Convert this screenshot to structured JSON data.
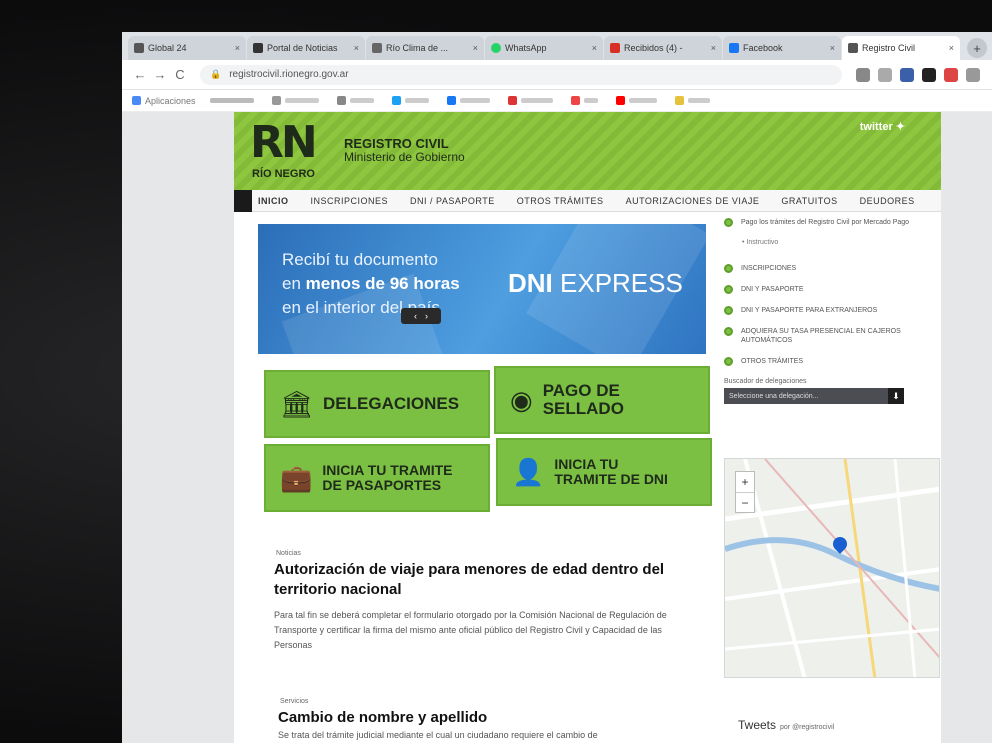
{
  "browser": {
    "tabs": [
      {
        "label": "Global 24",
        "active": false,
        "color": "#555555"
      },
      {
        "label": "Portal de Noticias",
        "active": false,
        "color": "#333333"
      },
      {
        "label": "Río Clima de ...",
        "active": false,
        "color": "#666666"
      },
      {
        "label": "WhatsApp",
        "active": false,
        "color": "#25d366"
      },
      {
        "label": "Recibidos (4) -",
        "active": false,
        "color": "#d93025"
      },
      {
        "label": "Facebook",
        "active": false,
        "color": "#1877f2"
      },
      {
        "label": "Registro Civil",
        "active": true,
        "color": "#555555"
      }
    ],
    "new_tab": "+",
    "close_glyph": "×",
    "url": "registrocivil.rionegro.gov.ar",
    "nav": {
      "back": "←",
      "forward": "→",
      "reload": "C"
    },
    "bookmarks": [
      "Aplicaciones"
    ]
  },
  "site": {
    "logo": "RN",
    "logo_sub": "RÍO NEGRO",
    "title": "REGISTRO CIVIL",
    "subtitle": "Ministerio de Gobierno",
    "twitter": "twitter",
    "nav": [
      "INICIO",
      "INSCRIPCIONES",
      "DNI / PASAPORTE",
      "OTROS TRÁMITES",
      "AUTORIZACIONES DE VIAJE",
      "GRATUITOS",
      "DEUDORES"
    ],
    "banner": {
      "line1": "Recibí tu documento",
      "line2a": "en ",
      "line2b": "menos de 96 horas",
      "line3": "en el interior del país",
      "brand_a": "DNI",
      "brand_b": " EXPRESS",
      "prev": "‹",
      "next": "›"
    },
    "tiles": [
      {
        "label": "DELEGACIONES",
        "icon": "institution-icon",
        "glyph": "🏛"
      },
      {
        "label": "PAGO DE\nSELLADO",
        "icon": "coins-icon",
        "glyph": "◉"
      },
      {
        "label": "INICIA TU TRAMITE\nDE PASAPORTES",
        "icon": "briefcase-icon",
        "glyph": "💼"
      },
      {
        "label": "INICIA TU\nTRAMITE DE DNI",
        "icon": "id-card-icon",
        "glyph": "🪪"
      }
    ],
    "news": [
      {
        "kicker": "Noticias",
        "title": "Autorización de viaje para menores de edad dentro del territorio nacional",
        "body": "Para tal fin se deberá completar el formulario otorgado por la Comisión Nacional de Regulación de Transporte y certificar la firma del mismo ante oficial público del Registro Civil y Capacidad de las Personas"
      },
      {
        "kicker": "Servicios",
        "title": "Cambio de nombre y apellido",
        "body": "Se trata del trámite judicial mediante el cual un ciudadano requiere el cambio de"
      }
    ],
    "sidebar": {
      "items": [
        "Pago los trámites del Registro Civil por Mercado Pago",
        "INSCRIPCIONES",
        "DNI Y PASAPORTE",
        "DNI Y PASAPORTE PARA EXTRANJEROS",
        "ADQUIERA SU TASA PRESENCIAL EN CAJEROS AUTOMÁTICOS",
        "OTROS TRÁMITES"
      ],
      "subitem": "Instructivo",
      "delegaciones_label": "Buscador de delegaciones",
      "select_placeholder": "Seleccione una delegación...",
      "select_arrow": "⬇",
      "map_zoom_in": "+",
      "map_zoom_out": "−",
      "tweets": "Tweets",
      "tweets_by": "por @registrocivil"
    }
  },
  "colors": {
    "green": "#8ec63f",
    "dark": "#1e2a1a",
    "banner_blue": "#2b6eb8"
  }
}
